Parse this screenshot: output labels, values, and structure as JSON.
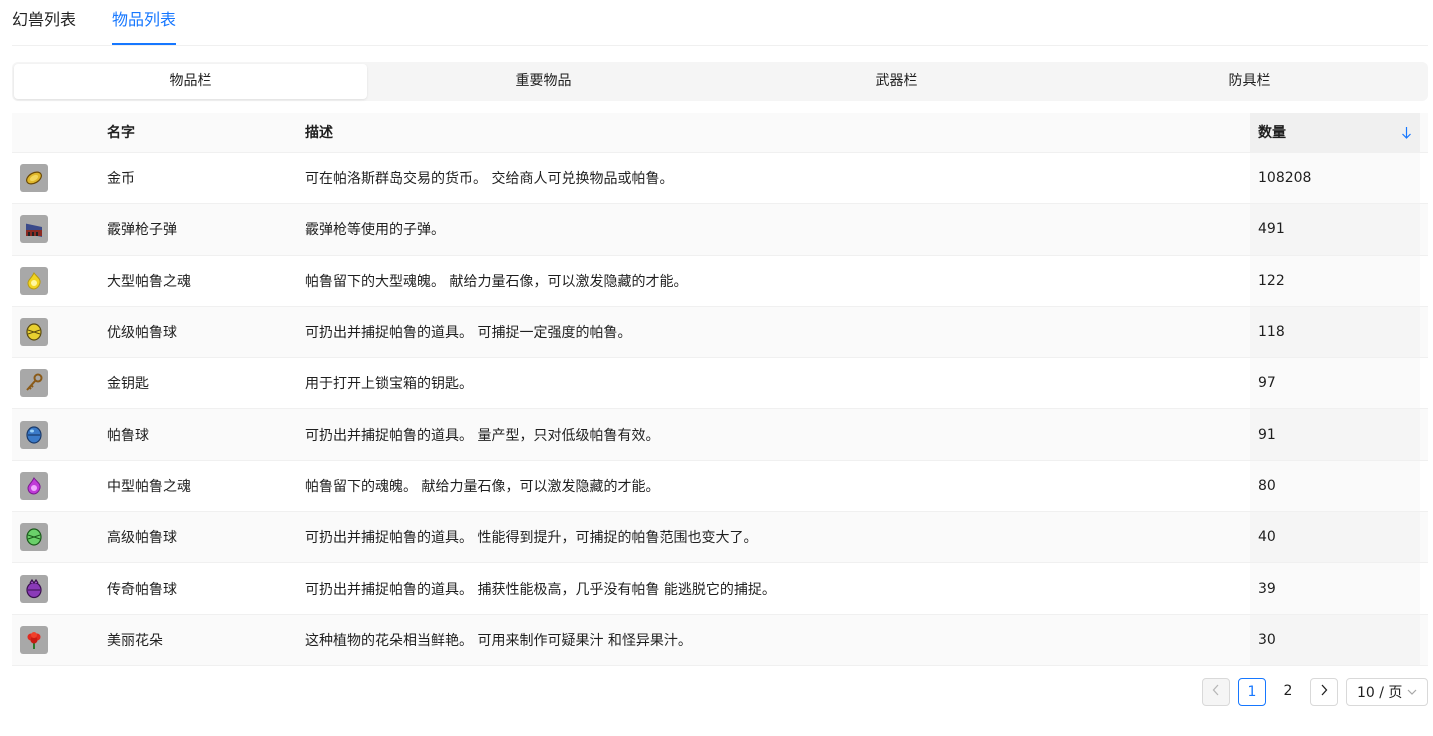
{
  "top_tabs": [
    {
      "label": "幻兽列表"
    },
    {
      "label": "物品列表"
    }
  ],
  "segments": [
    {
      "label": "物品栏"
    },
    {
      "label": "重要物品"
    },
    {
      "label": "武器栏"
    },
    {
      "label": "防具栏"
    }
  ],
  "table": {
    "headers": {
      "name": "名字",
      "desc": "描述",
      "qty": "数量"
    },
    "sort_icon": "arrow-down-icon",
    "rows": [
      {
        "icon": "gold-coin-icon",
        "name": "金币",
        "desc": "可在帕洛斯群岛交易的货币。 交给商人可兑换物品或帕鲁。",
        "qty": "108208"
      },
      {
        "icon": "shotgun-shell-icon",
        "name": "霰弹枪子弹",
        "desc": "霰弹枪等使用的子弹。",
        "qty": "491"
      },
      {
        "icon": "large-soul-icon",
        "name": "大型帕鲁之魂",
        "desc": "帕鲁留下的大型魂魄。 献给力量石像，可以激发隐藏的才能。",
        "qty": "122"
      },
      {
        "icon": "great-sphere-icon",
        "name": "优级帕鲁球",
        "desc": "可扔出并捕捉帕鲁的道具。 可捕捉一定强度的帕鲁。",
        "qty": "118"
      },
      {
        "icon": "golden-key-icon",
        "name": "金钥匙",
        "desc": "用于打开上锁宝箱的钥匙。",
        "qty": "97"
      },
      {
        "icon": "pal-sphere-icon",
        "name": "帕鲁球",
        "desc": "可扔出并捕捉帕鲁的道具。 量产型，只对低级帕鲁有效。",
        "qty": "91"
      },
      {
        "icon": "medium-soul-icon",
        "name": "中型帕鲁之魂",
        "desc": "帕鲁留下的魂魄。 献给力量石像，可以激发隐藏的才能。",
        "qty": "80"
      },
      {
        "icon": "mega-sphere-icon",
        "name": "高级帕鲁球",
        "desc": "可扔出并捕捉帕鲁的道具。 性能得到提升，可捕捉的帕鲁范围也变大了。",
        "qty": "40"
      },
      {
        "icon": "legendary-sphere-icon",
        "name": "传奇帕鲁球",
        "desc": "可扔出并捕捉帕鲁的道具。 捕获性能极高，几乎没有帕鲁 能逃脱它的捕捉。",
        "qty": "39"
      },
      {
        "icon": "flower-icon",
        "name": "美丽花朵",
        "desc": "这种植物的花朵相当鲜艳。 可用来制作可疑果汁 和怪异果汁。",
        "qty": "30"
      }
    ]
  },
  "pagination": {
    "pages": [
      "1",
      "2"
    ],
    "page_size": "10 / 页"
  },
  "colors": {
    "accent": "#1677ff"
  }
}
